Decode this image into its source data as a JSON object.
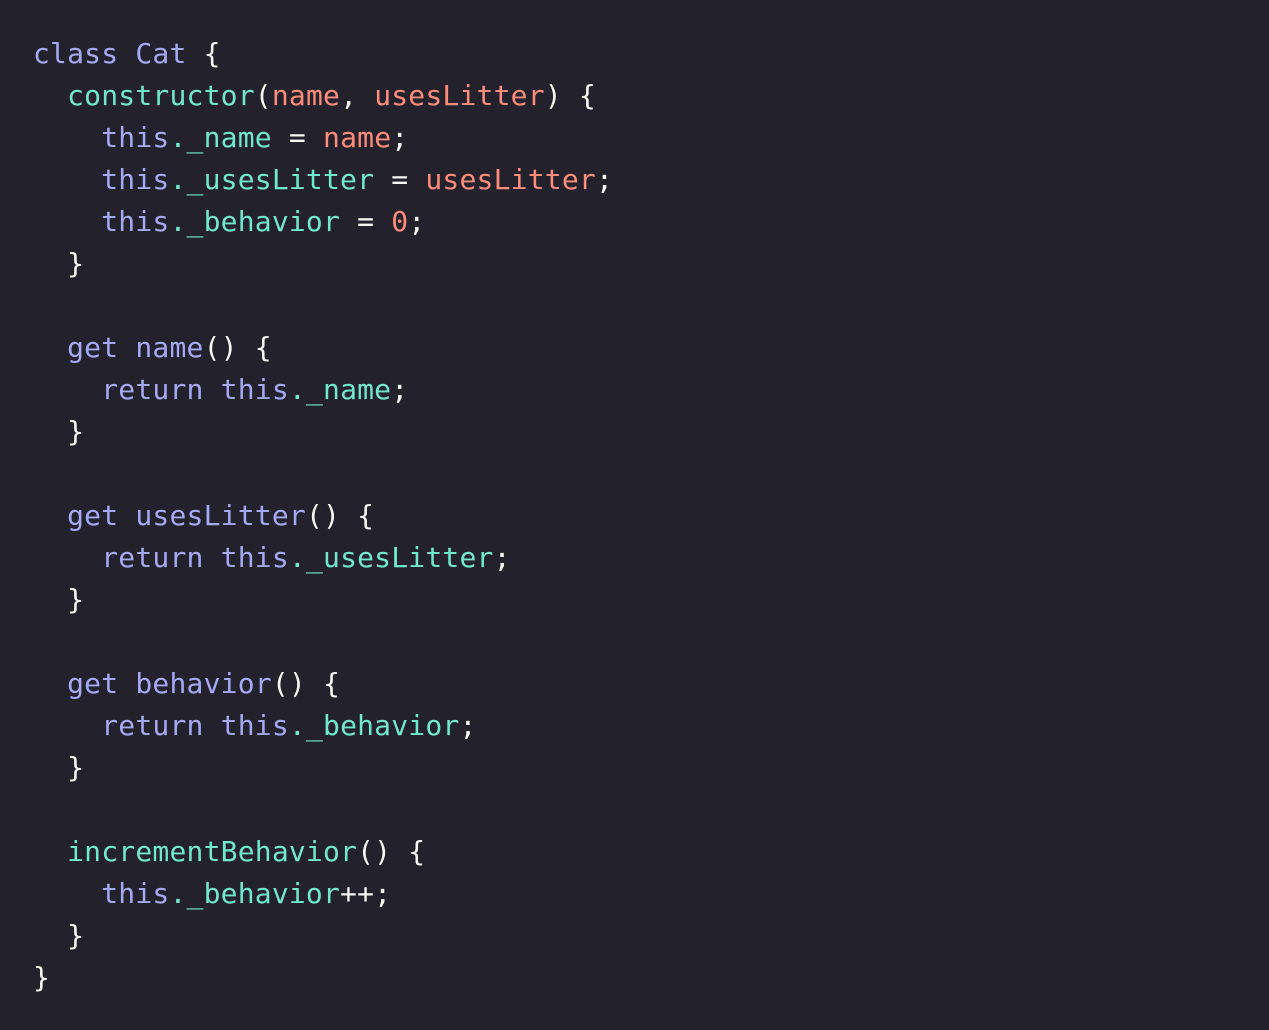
{
  "editor": {
    "background_color": "#22212C",
    "language": "javascript",
    "default_text_color": "#F8F8F2",
    "font_size_px": 28,
    "line_height_px": 42,
    "indent_spaces": 4
  },
  "theme": {
    "keyword_color": "#A5A8F3",
    "method_color": "#6FE8CE",
    "property_color": "#6FE8CE",
    "parameter_color": "#FF8B7A",
    "number_color": "#FF8B7A",
    "punctuation_color": "#F8F8F2"
  },
  "code": {
    "raw": "class Cat {\n  constructor(name, usesLitter) {\n    this._name = name;\n    this._usesLitter = usesLitter;\n    this._behavior = 0;\n  }\n\n  get name() {\n    return this._name;\n  }\n\n  get usesLitter() {\n    return this._usesLitter;\n  }\n\n  get behavior() {\n    return this._behavior;\n  }\n\n  incrementBehavior() {\n    this._behavior++;\n  }\n}",
    "lines": [
      "class Cat {",
      "  constructor(name, usesLitter) {",
      "    this._name = name;",
      "    this._usesLitter = usesLitter;",
      "    this._behavior = 0;",
      "  }",
      "",
      "  get name() {",
      "    return this._name;",
      "  }",
      "",
      "  get usesLitter() {",
      "    return this._usesLitter;",
      "  }",
      "",
      "  get behavior() {",
      "    return this._behavior;",
      "  }",
      "",
      "  incrementBehavior() {",
      "    this._behavior++;",
      "  }",
      "}"
    ],
    "tokens": {
      "kw_class": "class",
      "class_name": "Cat",
      "kw_get": "get",
      "kw_return": "return",
      "kw_this": "this",
      "method_constructor": "constructor",
      "method_increment": "incrementBehavior",
      "getter_name": "name",
      "getter_usesLitter": "usesLitter",
      "getter_behavior": "behavior",
      "param_name": "name",
      "param_usesLitter": "usesLitter",
      "prop_name": "._name",
      "prop_usesLitter": "._usesLitter",
      "prop_behavior": "._behavior",
      "number_zero": "0",
      "op_assign": "=",
      "op_increment": "++",
      "brace_open": "{",
      "brace_close": "}",
      "paren_open": "(",
      "paren_close": ")",
      "paren_empty": "()",
      "semicolon": ";",
      "comma_space": ", ",
      "indent1": "  ",
      "indent2": "    ",
      "space": " "
    }
  }
}
